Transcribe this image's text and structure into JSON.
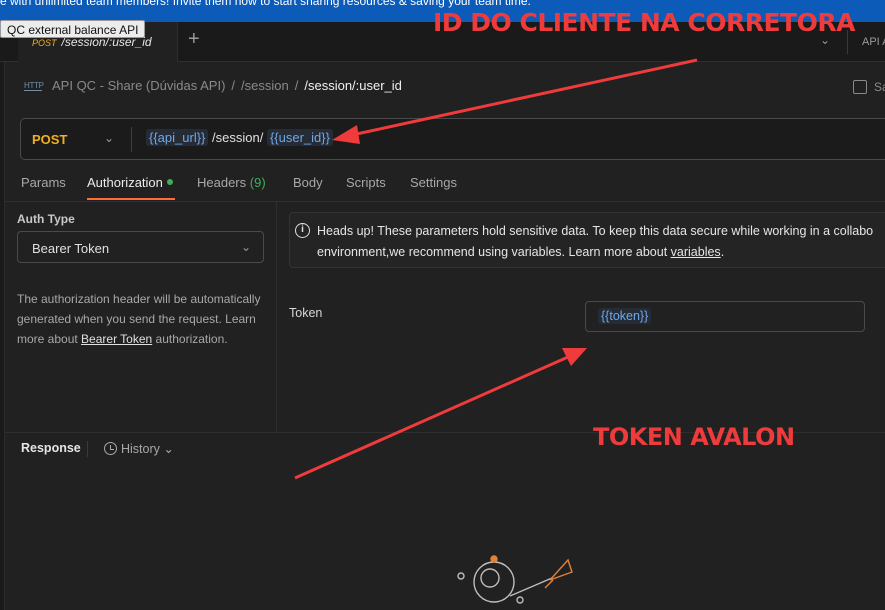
{
  "banner": {
    "text": "e with unlimited team members! Invite them now to start sharing resources & saving your team time."
  },
  "tooltip": {
    "text": "QC external balance API"
  },
  "tab": {
    "method": "POST",
    "path": "/session/:user_id",
    "env_label": "API A"
  },
  "breadcrumb": {
    "icon_text": "HTTP",
    "collection": "API QC - Share (Dúvidas API)",
    "folder": "/session",
    "current": "/session/:user_id",
    "save_label": "Sa"
  },
  "request": {
    "method": "POST",
    "url_parts": {
      "var1": "{{api_url}}",
      "mid": " /session/ ",
      "var2": "{{user_id}}"
    }
  },
  "request_tabs": {
    "params": "Params",
    "authorization": "Authorization",
    "headers": "Headers",
    "headers_count": "(9)",
    "body": "Body",
    "scripts": "Scripts",
    "settings": "Settings"
  },
  "auth": {
    "type_label": "Auth Type",
    "type_value": "Bearer Token",
    "help_before": "The authorization header will be automatically generated when you send the request. Learn more about ",
    "help_link": "Bearer Token",
    "help_after": " authorization."
  },
  "notice": {
    "line1": "Heads up! These parameters hold sensitive data. To keep this data secure while working in a collabo",
    "line2_before": "environment,we recommend using variables. Learn more about ",
    "line2_link": "variables",
    "line2_after": "."
  },
  "token": {
    "label": "Token",
    "value": "{{token}}"
  },
  "response": {
    "label": "Response",
    "history": "History"
  },
  "annotations": {
    "top": "ID DO CLIENTE NA CORRETORA",
    "token": "TOKEN AVALON"
  },
  "colors": {
    "annotation": "#ef3b3b",
    "method": "#f2b01d",
    "variable": "#6ea8e8",
    "active_tab_underline": "#ff6c37",
    "status_dot": "#3fae5a"
  }
}
